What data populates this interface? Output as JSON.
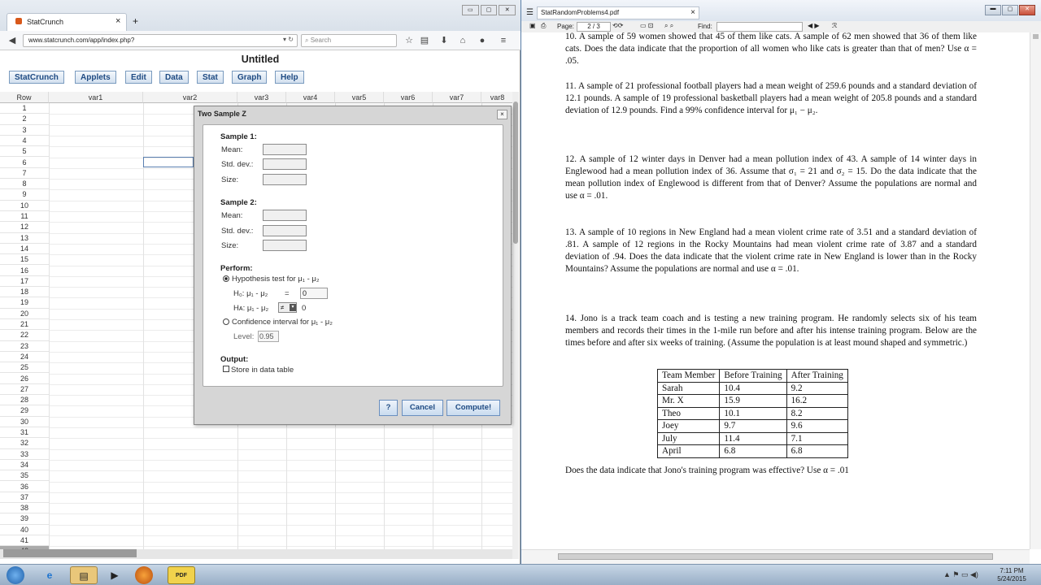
{
  "browser": {
    "tab_title": "StatCrunch",
    "tab_close": "×",
    "new_tab": "+",
    "url": "www.statcrunch.com/app/index.php?",
    "search_placeholder": "Search",
    "win_buttons": [
      "▭",
      "▢",
      "✕"
    ]
  },
  "statcrunch": {
    "title": "Untitled",
    "menu": [
      "StatCrunch",
      "Applets",
      "Edit",
      "Data",
      "Stat",
      "Graph",
      "Help"
    ],
    "columns": [
      "Row",
      "var1",
      "var2",
      "var3",
      "var4",
      "var5",
      "var6",
      "var7",
      "var8"
    ],
    "rows": [
      "1",
      "2",
      "3",
      "4",
      "5",
      "6",
      "7",
      "8",
      "9",
      "10",
      "11",
      "12",
      "13",
      "14",
      "15",
      "16",
      "17",
      "18",
      "19",
      "20",
      "21",
      "22",
      "23",
      "24",
      "25",
      "26",
      "27",
      "28",
      "29",
      "30",
      "31",
      "32",
      "33",
      "34",
      "35",
      "36",
      "37",
      "38",
      "39",
      "40",
      "41",
      "42"
    ]
  },
  "dialog": {
    "title": "Two Sample Z",
    "close": "×",
    "sample1_heading": "Sample 1:",
    "sample2_heading": "Sample 2:",
    "mean_label": "Mean:",
    "std_label": "Std. dev.:",
    "size_label": "Size:",
    "perform_heading": "Perform:",
    "hypothesis_label": "Hypothesis test for μ₁ - μ₂",
    "h0_label": "H₀: μ₁ - μ₂",
    "h0_eq": "=",
    "h0_value": "0",
    "ha_label": "Hᴀ: μ₁ - μ₂",
    "ha_op": "≠",
    "ha_value": "0",
    "ci_label": "Confidence interval for μ₁ - μ₂",
    "level_label": "Level:",
    "level_value": "0.95",
    "output_heading": "Output:",
    "store_label": "Store in data table",
    "help_button": "?",
    "cancel_button": "Cancel",
    "compute_button": "Compute!"
  },
  "pdf": {
    "title": "StatRandomProblems4.pdf",
    "close": "×",
    "page_label": "Page:",
    "page_value": "2",
    "page_total": "/ 3",
    "find_label": "Find:",
    "p10": "10. A sample of 59 women showed that 45 of them like cats. A sample of 62 men showed that 36 of them like cats. Does the data indicate that the proportion of all women who like cats is greater than that of men? Use α = .05.",
    "p11": "11. A sample of 21 professional football players had a mean weight of 259.6 pounds and a standard deviation of 12.1 pounds. A sample of 19 professional basketball players had a mean weight of 205.8 pounds and a standard deviation of 12.9 pounds. Find a 99% confidence interval for μ₁ − μ₂.",
    "p12": "12. A sample of 12 winter days in Denver had a mean pollution index of 43. A sample of 14 winter days in Englewood had a mean pollution index of 36. Assume that σ₁ = 21 and σ₂ = 15. Do the data indicate that the mean pollution index of Englewood is different from that of Denver? Assume the populations are normal and use α = .01.",
    "p13": "13. A sample of 10 regions in New England had a mean violent crime rate of 3.51 and a standard deviation of .81. A sample of 12 regions in the Rocky Mountains had mean violent crime rate of 3.87 and a standard deviation of .94. Does the data indicate that the violent crime rate in New England is lower than in the Rocky Mountains? Assume the populations are normal and use α = .01.",
    "p14": "14. Jono is a track team coach and is testing a new training program. He randomly selects six of his team members and records their times in the 1-mile run before and after his intense training program. Below are the times before and after six weeks of training. (Assume the population is at least mound shaped and symmetric.)",
    "table_headers": [
      "Team Member",
      "Before Training",
      "After Training"
    ],
    "table_rows": [
      [
        "Sarah",
        "10.4",
        "9.2"
      ],
      [
        "Mr. X",
        "15.9",
        "16.2"
      ],
      [
        "Theo",
        "10.1",
        "8.2"
      ],
      [
        "Joey",
        "9.7",
        "9.6"
      ],
      [
        "July",
        "11.4",
        "7.1"
      ],
      [
        "April",
        "6.8",
        "6.8"
      ]
    ],
    "question": "Does the data indicate that Jono's training program was effective? Use α = .01"
  },
  "taskbar": {
    "time": "7:11 PM",
    "date": "5/24/2015",
    "pdf_icon_text": "PDF"
  },
  "colors": {
    "accent": "#1e4a82",
    "desktop": "#5a7fa8"
  }
}
